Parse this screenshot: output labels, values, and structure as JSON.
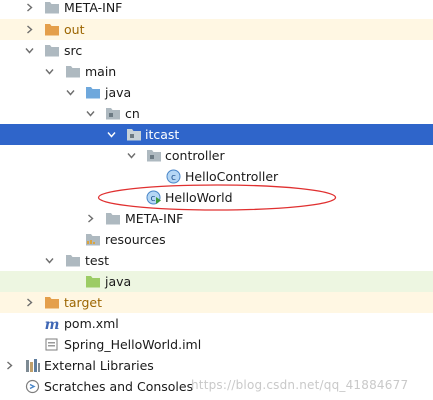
{
  "tree": {
    "meta_inf_top": "META-INF",
    "out": "out",
    "src": "src",
    "main": "main",
    "java_main": "java",
    "cn": "cn",
    "itcast": "itcast",
    "controller": "controller",
    "hello_controller": "HelloController",
    "hello_world": "HelloWorld",
    "meta_inf": "META-INF",
    "resources": "resources",
    "test": "test",
    "java_test": "java",
    "target": "target",
    "pom": "pom.xml",
    "iml": "Spring_HelloWorld.iml",
    "external_libraries": "External Libraries",
    "scratches": "Scratches and Consoles"
  },
  "watermark": "https://blog.csdn.net/qq_41884677",
  "colors": {
    "selection": "#2f65ca",
    "test_root_bg": "#edf6e1",
    "excluded_bg": "#fff7e3",
    "folder": "#aeb9c0",
    "folder_excluded": "#e49f4b",
    "folder_test": "#9ccc65",
    "annotation": "#e03030"
  },
  "icons": {
    "expanded_arrow": "chevron-down-icon",
    "collapsed_arrow": "chevron-right-icon",
    "folder": "folder-icon",
    "package": "package-folder-icon",
    "class": "java-class-icon",
    "main_class": "java-runnable-class-icon",
    "maven": "maven-icon",
    "module_file": "module-file-icon",
    "libraries": "libraries-icon",
    "scratches": "scratches-icon"
  }
}
